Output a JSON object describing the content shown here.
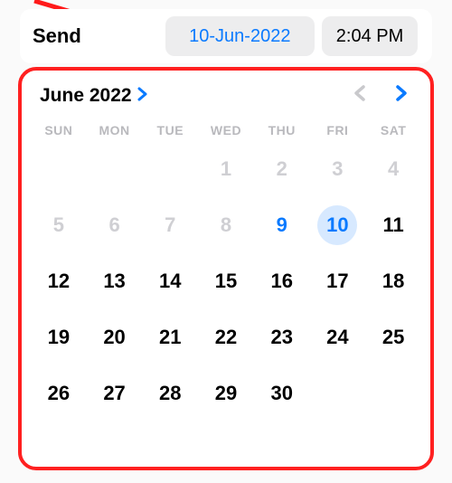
{
  "toolbar": {
    "send_label": "Send",
    "date_value": "10-Jun-2022",
    "time_value": "2:04 PM"
  },
  "annotation": {
    "arrow_color": "#ff1a1a",
    "highlight_border_color": "#ff2020"
  },
  "calendar": {
    "month_label": "June 2022",
    "weekdays": [
      "SUN",
      "MON",
      "TUE",
      "WED",
      "THU",
      "FRI",
      "SAT"
    ],
    "today_day": 9,
    "selected_day": 10,
    "cells": [
      {
        "n": "",
        "s": "blank"
      },
      {
        "n": "",
        "s": "blank"
      },
      {
        "n": "",
        "s": "blank"
      },
      {
        "n": "1",
        "s": "out"
      },
      {
        "n": "2",
        "s": "out"
      },
      {
        "n": "3",
        "s": "out"
      },
      {
        "n": "4",
        "s": "out"
      },
      {
        "n": "5",
        "s": "out"
      },
      {
        "n": "6",
        "s": "out"
      },
      {
        "n": "7",
        "s": "out"
      },
      {
        "n": "8",
        "s": "out"
      },
      {
        "n": "9",
        "s": "highlight"
      },
      {
        "n": "10",
        "s": "selected"
      },
      {
        "n": "11",
        "s": "in"
      },
      {
        "n": "12",
        "s": "in"
      },
      {
        "n": "13",
        "s": "in"
      },
      {
        "n": "14",
        "s": "in"
      },
      {
        "n": "15",
        "s": "in"
      },
      {
        "n": "16",
        "s": "in"
      },
      {
        "n": "17",
        "s": "in"
      },
      {
        "n": "18",
        "s": "in"
      },
      {
        "n": "19",
        "s": "in"
      },
      {
        "n": "20",
        "s": "in"
      },
      {
        "n": "21",
        "s": "in"
      },
      {
        "n": "22",
        "s": "in"
      },
      {
        "n": "23",
        "s": "in"
      },
      {
        "n": "24",
        "s": "in"
      },
      {
        "n": "25",
        "s": "in"
      },
      {
        "n": "26",
        "s": "in"
      },
      {
        "n": "27",
        "s": "in"
      },
      {
        "n": "28",
        "s": "in"
      },
      {
        "n": "29",
        "s": "in"
      },
      {
        "n": "30",
        "s": "in"
      },
      {
        "n": "",
        "s": "blank"
      },
      {
        "n": "",
        "s": "blank"
      }
    ]
  }
}
